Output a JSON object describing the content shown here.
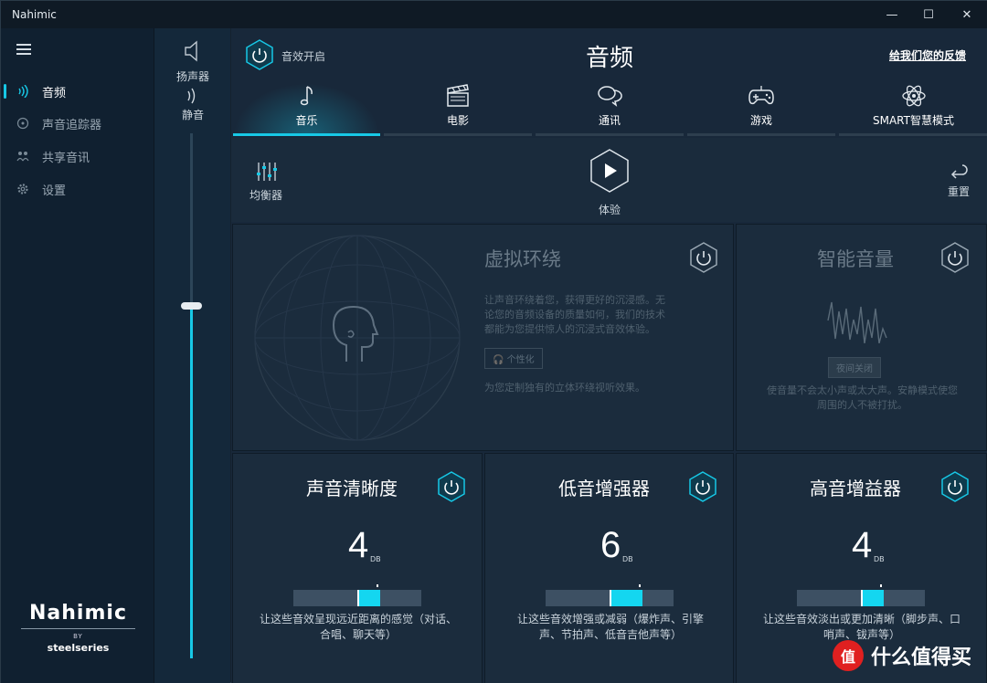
{
  "window": {
    "title": "Nahimic",
    "controls": {
      "minimize": "—",
      "maximize": "☐",
      "close": "✕"
    }
  },
  "sidebar": {
    "items": [
      {
        "label": "音频",
        "icon": "audio-wave-icon",
        "active": true
      },
      {
        "label": "声音追踪器",
        "icon": "sound-tracker-icon",
        "active": false
      },
      {
        "label": "共享音讯",
        "icon": "share-audio-icon",
        "active": false
      },
      {
        "label": "设置",
        "icon": "gear-icon",
        "active": false
      }
    ],
    "brand": {
      "logo": "Nahimic",
      "by": "BY",
      "partner": "steelseries"
    }
  },
  "volume": {
    "device_label": "扬声器",
    "mute_label": "静音",
    "level": 0.67
  },
  "header": {
    "sound_on_label": "音效开启",
    "title": "音频",
    "feedback_label": "给我们您的反馈"
  },
  "tabs": [
    {
      "label": "音乐",
      "icon": "music-note-icon",
      "active": true
    },
    {
      "label": "电影",
      "icon": "clapperboard-icon",
      "active": false
    },
    {
      "label": "通讯",
      "icon": "chat-icon",
      "active": false
    },
    {
      "label": "游戏",
      "icon": "gamepad-icon",
      "active": false
    },
    {
      "label": "SMART智慧模式",
      "icon": "atom-icon",
      "active": false
    }
  ],
  "toolbar": {
    "equalizer_label": "均衡器",
    "experience_label": "体验",
    "reset_label": "重置"
  },
  "surround": {
    "title": "虚拟环绕",
    "desc": "让声音环绕着您，获得更好的沉浸感。无论您的音频设备的质量如何，我们的技术都能为您提供惊人的沉浸式音效体验。",
    "personalize_label": "个性化",
    "hint": "为您定制独有的立体环绕视听效果。"
  },
  "smart_volume": {
    "title": "智能音量",
    "level_label": "夜间关闭",
    "desc": "使音量不会太小声或太大声。安静模式使您周围的人不被打扰。"
  },
  "cards": [
    {
      "title": "声音清晰度",
      "value": "4",
      "unit": "DB",
      "level": 0.5,
      "desc": "让这些音效呈现远近距离的感觉（对话、合唱、聊天等）"
    },
    {
      "title": "低音增强器",
      "value": "6",
      "unit": "DB",
      "level": 0.54,
      "desc": "让这些音效增强或减弱（爆炸声、引擎声、节拍声、低音吉他声等）"
    },
    {
      "title": "高音增益器",
      "value": "4",
      "unit": "DB",
      "level": 0.5,
      "desc": "让这些音效淡出或更加清晰（脚步声、口哨声、钹声等）"
    }
  ],
  "watermark": {
    "badge": "值",
    "text": "什么值得买"
  },
  "colors": {
    "accent": "#17c8e6",
    "background": "#18283a",
    "sidebar": "#102030"
  }
}
